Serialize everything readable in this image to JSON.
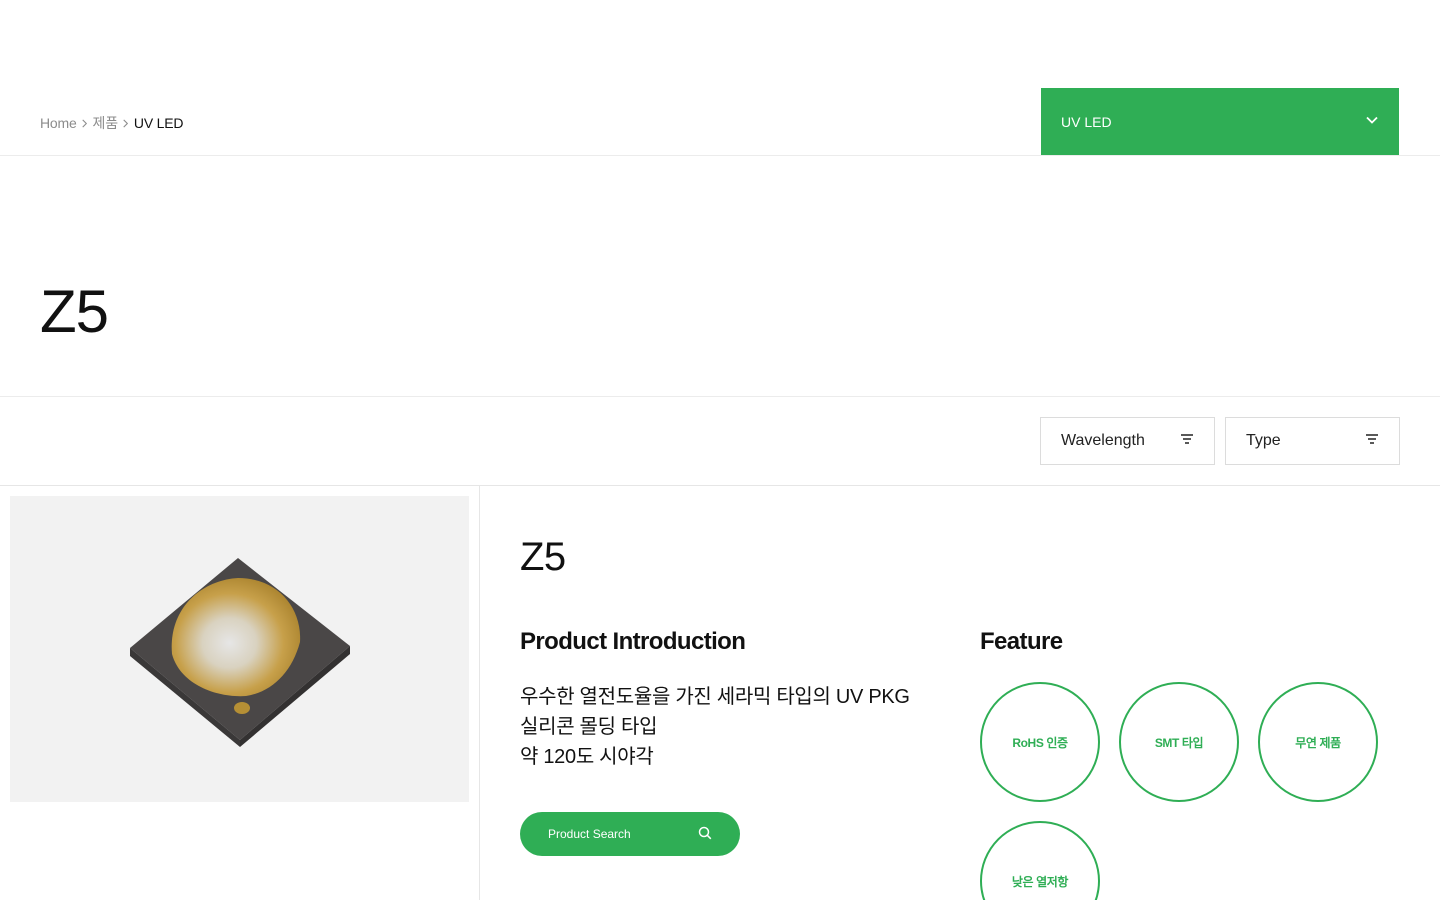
{
  "breadcrumb": {
    "items": [
      "Home",
      "제품",
      "UV LED"
    ]
  },
  "category_select": {
    "value": "UV LED",
    "icon": "chevron-down-icon"
  },
  "page": {
    "title": "Z5"
  },
  "filters": {
    "wavelength_label": "Wavelength",
    "type_label": "Type",
    "icon": "filter-lines-icon"
  },
  "product": {
    "name": "Z5",
    "intro_heading": "Product Introduction",
    "intro_lines": [
      "우수한 열전도율을 가진 세라믹 타입의 UV PKG",
      "실리콘 몰딩 타입",
      "약 120도 시야각"
    ],
    "search_button_label": "Product Search",
    "search_icon": "search-icon",
    "feature_heading": "Feature",
    "features": [
      "RoHS 인증",
      "SMT 타입",
      "무연 제품",
      "낮은 열저항"
    ]
  },
  "colors": {
    "accent": "#2fae55",
    "text": "#111111",
    "muted": "#8c8c8c",
    "image_bg": "#f2f2f2"
  }
}
